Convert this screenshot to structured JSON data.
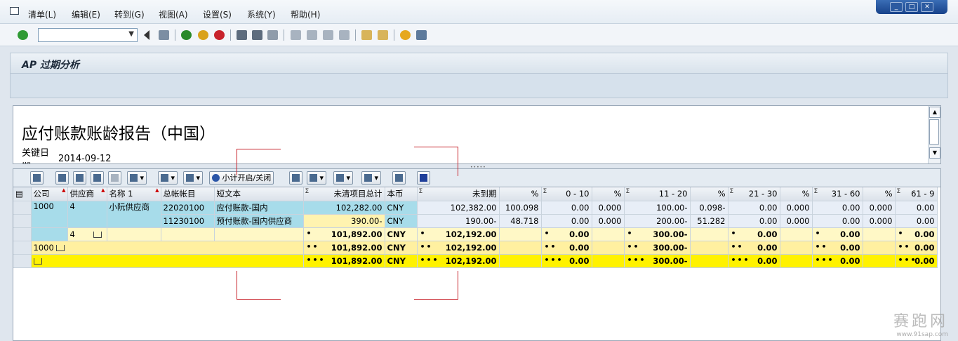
{
  "menu": [
    "清单(L)",
    "编辑(E)",
    "转到(G)",
    "视图(A)",
    "设置(S)",
    "系统(Y)",
    "帮助(H)"
  ],
  "window_controls": [
    "_",
    "□",
    "✕"
  ],
  "command_field": {
    "value": ""
  },
  "page_title": "AP 过期分析",
  "report": {
    "title": "应付账款账龄报告（中国）",
    "key_date_label": "关键日",
    "key_date_value": "2014-09-12",
    "cut_label": "期"
  },
  "alv_toolbar": {
    "subtotal_toggle_label": "小计开启/关闭"
  },
  "columns": [
    "公司",
    "供应商",
    "名称 1",
    "总帐帐目",
    "短文本",
    "未清项目总计",
    "本币",
    "未到期",
    "%",
    "0 - 10",
    "%",
    "11 - 20",
    "%",
    "21 - 30",
    "%",
    "31 - 60",
    "%",
    "61 - 9"
  ],
  "rows": [
    {
      "company": "1000",
      "vendor": "4",
      "name": "小阮供应商",
      "gl": "22020100",
      "text": "应付账款-国内",
      "total": "102,282.00",
      "cur": "CNY",
      "not_due": "102,382.00",
      "p0": "100.098",
      "b1": "0.00",
      "p1": "0.000",
      "b2": "100.00-",
      "p2": "0.098-",
      "b3": "0.00",
      "p3": "0.000",
      "b4": "0.00",
      "p4": "0.000",
      "b5": "0.00"
    },
    {
      "company": "",
      "vendor": "",
      "name": "",
      "gl": "11230100",
      "text": "预付账款-国内供应商",
      "total": "390.00-",
      "cur": "CNY",
      "not_due": "190.00-",
      "p0": "48.718",
      "b1": "0.00",
      "p1": "0.000",
      "b2": "200.00-",
      "p2": "51.282",
      "b3": "0.00",
      "p3": "0.000",
      "b4": "0.00",
      "p4": "0.000",
      "b5": "0.00"
    }
  ],
  "subtotal_vendor": {
    "label": "4",
    "total": "101,892.00",
    "cur": "CNY",
    "not_due": "102,192.00",
    "b1": "0.00",
    "b2": "300.00-",
    "b3": "0.00",
    "b4": "0.00",
    "b5": "0.00"
  },
  "subtotal_company": {
    "label": "1000",
    "total": "101,892.00",
    "cur": "CNY",
    "not_due": "102,192.00",
    "b1": "0.00",
    "b2": "300.00-",
    "b3": "0.00",
    "b4": "0.00",
    "b5": "0.00"
  },
  "grand_total": {
    "total": "101,892.00",
    "cur": "CNY",
    "not_due": "102,192.00",
    "b1": "0.00",
    "b2": "300.00-",
    "b3": "0.00",
    "b4": "0.00",
    "b5": "0.00"
  },
  "watermark": {
    "text": "赛跑网",
    "url": "www.91sap.com"
  },
  "colors": {
    "key_cell": "#a7dcea",
    "subtotal1": "#fff8c6",
    "subtotal2": "#fff0a0",
    "grand_total": "#fff200",
    "crop_mark": "#c8232c"
  }
}
